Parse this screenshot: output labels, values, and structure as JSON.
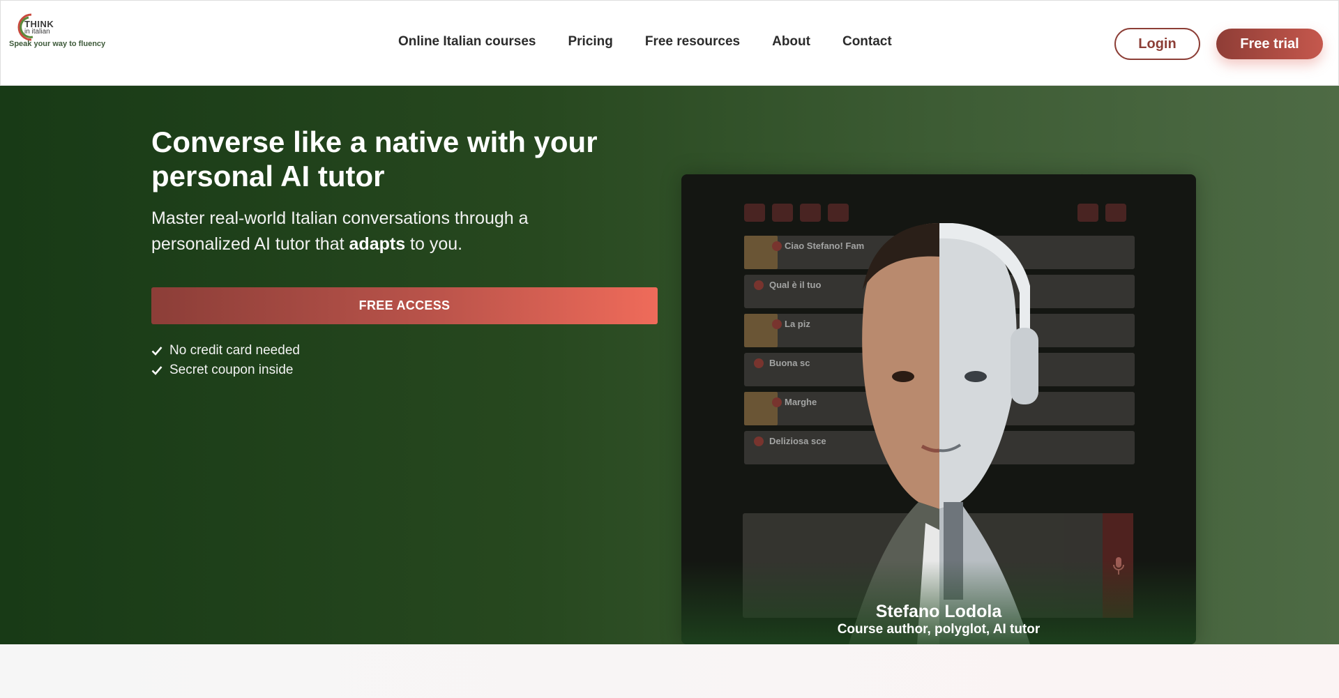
{
  "brand": {
    "logo_line1": "THINK",
    "logo_line2": "in italian",
    "tagline": "Speak your way to fluency",
    "colors": {
      "green": "#2a4a22",
      "red": "#8c3e36",
      "accent": "#ef6b5a",
      "logo_arc_red": "#c94a3e",
      "logo_arc_green": "#5a8a3c"
    }
  },
  "nav": {
    "items": [
      {
        "label": "Online Italian courses"
      },
      {
        "label": "Pricing"
      },
      {
        "label": "Free resources"
      },
      {
        "label": "About"
      },
      {
        "label": "Contact"
      }
    ],
    "login_label": "Login",
    "trial_label": "Free trial"
  },
  "hero": {
    "title": "Converse like a native with your personal AI tutor",
    "subtitle_before": "Master real-world Italian conversations through a personalized AI tutor that ",
    "subtitle_bold": "adapts",
    "subtitle_after": " to you.",
    "cta_label": "FREE ACCESS",
    "checks": [
      {
        "label": "No credit card needed",
        "icon": "check-icon"
      },
      {
        "label": "Secret coupon inside",
        "icon": "check-icon"
      }
    ]
  },
  "media": {
    "chat_lines": [
      {
        "text": "Ciao Stefano! Fam"
      },
      {
        "text": "Qual è il tuo"
      },
      {
        "text": "La piz"
      },
      {
        "text": "Buona sc"
      },
      {
        "text": "Marghe"
      },
      {
        "text": "Deliziosa sce"
      }
    ],
    "author_name": "Stefano Lodola",
    "author_role": "Course author, polyglot, AI tutor"
  }
}
